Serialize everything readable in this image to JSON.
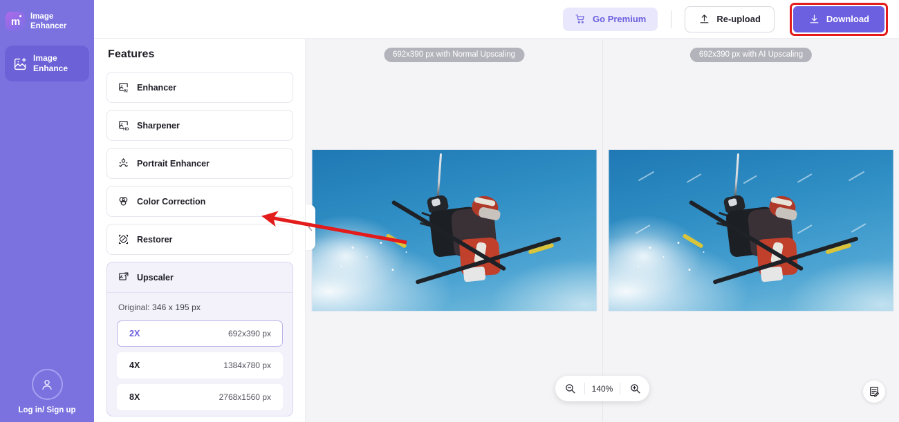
{
  "brand": {
    "name_line1": "Image",
    "name_line2": "Enhancer",
    "logo_glyph": "m"
  },
  "sidebar": {
    "nav": [
      {
        "label_line1": "Image",
        "label_line2": "Enhance",
        "icon": "image-plus-icon",
        "active": true
      }
    ],
    "account": {
      "label": "Log in/ Sign up",
      "icon": "user-icon"
    }
  },
  "panel": {
    "title": "Features",
    "features": [
      {
        "label": "Enhancer",
        "icon": "image-ai-icon"
      },
      {
        "label": "Sharpener",
        "icon": "image-hd-icon"
      },
      {
        "label": "Portrait Enhancer",
        "icon": "portrait-icon"
      },
      {
        "label": "Color Correction",
        "icon": "color-circles-icon"
      },
      {
        "label": "Restorer",
        "icon": "restore-patch-icon"
      }
    ],
    "upscaler": {
      "title": "Upscaler",
      "icon": "image-expand-icon",
      "original_label": "Original:",
      "original_value": "346 x 195 px",
      "options": [
        {
          "name": "2X",
          "dims": "692x390 px",
          "selected": true
        },
        {
          "name": "4X",
          "dims": "1384x780 px",
          "selected": false
        },
        {
          "name": "8X",
          "dims": "2768x1560 px",
          "selected": false
        }
      ]
    }
  },
  "topbar": {
    "premium_label": "Go Premium",
    "premium_icon": "cart-icon",
    "reupload_label": "Re-upload",
    "reupload_icon": "upload-icon",
    "download_label": "Download",
    "download_icon": "download-icon",
    "highlight_color": "#e31b1b",
    "accent_color": "#6c5fe0"
  },
  "canvas": {
    "panes": [
      {
        "badge": "692x390 px with Normal Upscaling",
        "image_alt": "skier-mid-air-jump-normal"
      },
      {
        "badge": "692x390 px with AI Upscaling",
        "image_alt": "skier-mid-air-jump-ai"
      }
    ],
    "zoom": {
      "value": "140%",
      "zoom_out_icon": "zoom-out-icon",
      "zoom_in_icon": "zoom-in-icon"
    },
    "feedback_icon": "feedback-note-icon",
    "collapse_icon": "chevron-left-icon"
  },
  "annotations": {
    "arrow_color": "#e31b1b",
    "arrow_target": "Color Correction"
  }
}
